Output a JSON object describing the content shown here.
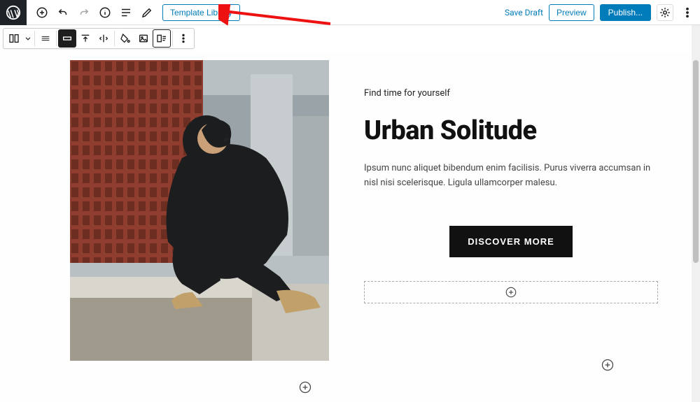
{
  "toolbar": {
    "template_library_label": "Template Library",
    "save_draft_label": "Save Draft",
    "preview_label": "Preview",
    "publish_label": "Publish..."
  },
  "block_toolbar": {
    "icons": [
      "columns-icon",
      "align-full-icon",
      "align-top-icon",
      "align-center-h-icon",
      "paint-icon",
      "image-icon",
      "media-text-icon",
      "more-options-icon"
    ]
  },
  "content": {
    "tagline": "Find time for yourself",
    "headline": "Urban Solitude",
    "body": "Ipsum nunc aliquet bibendum enim facilisis. Purus viverra accumsan in nisl nisi scelerisque. Ligula ullamcorper malesu.",
    "cta_label": "DISCOVER MORE"
  },
  "icons": {
    "add": "add-icon",
    "undo": "undo-icon",
    "redo": "redo-icon",
    "info": "info-icon",
    "outline": "outline-icon",
    "edit": "edit-icon",
    "settings": "settings-gear-icon",
    "more": "more-vertical-icon"
  },
  "colors": {
    "brand": "#007cba",
    "arrow": "#e11"
  }
}
